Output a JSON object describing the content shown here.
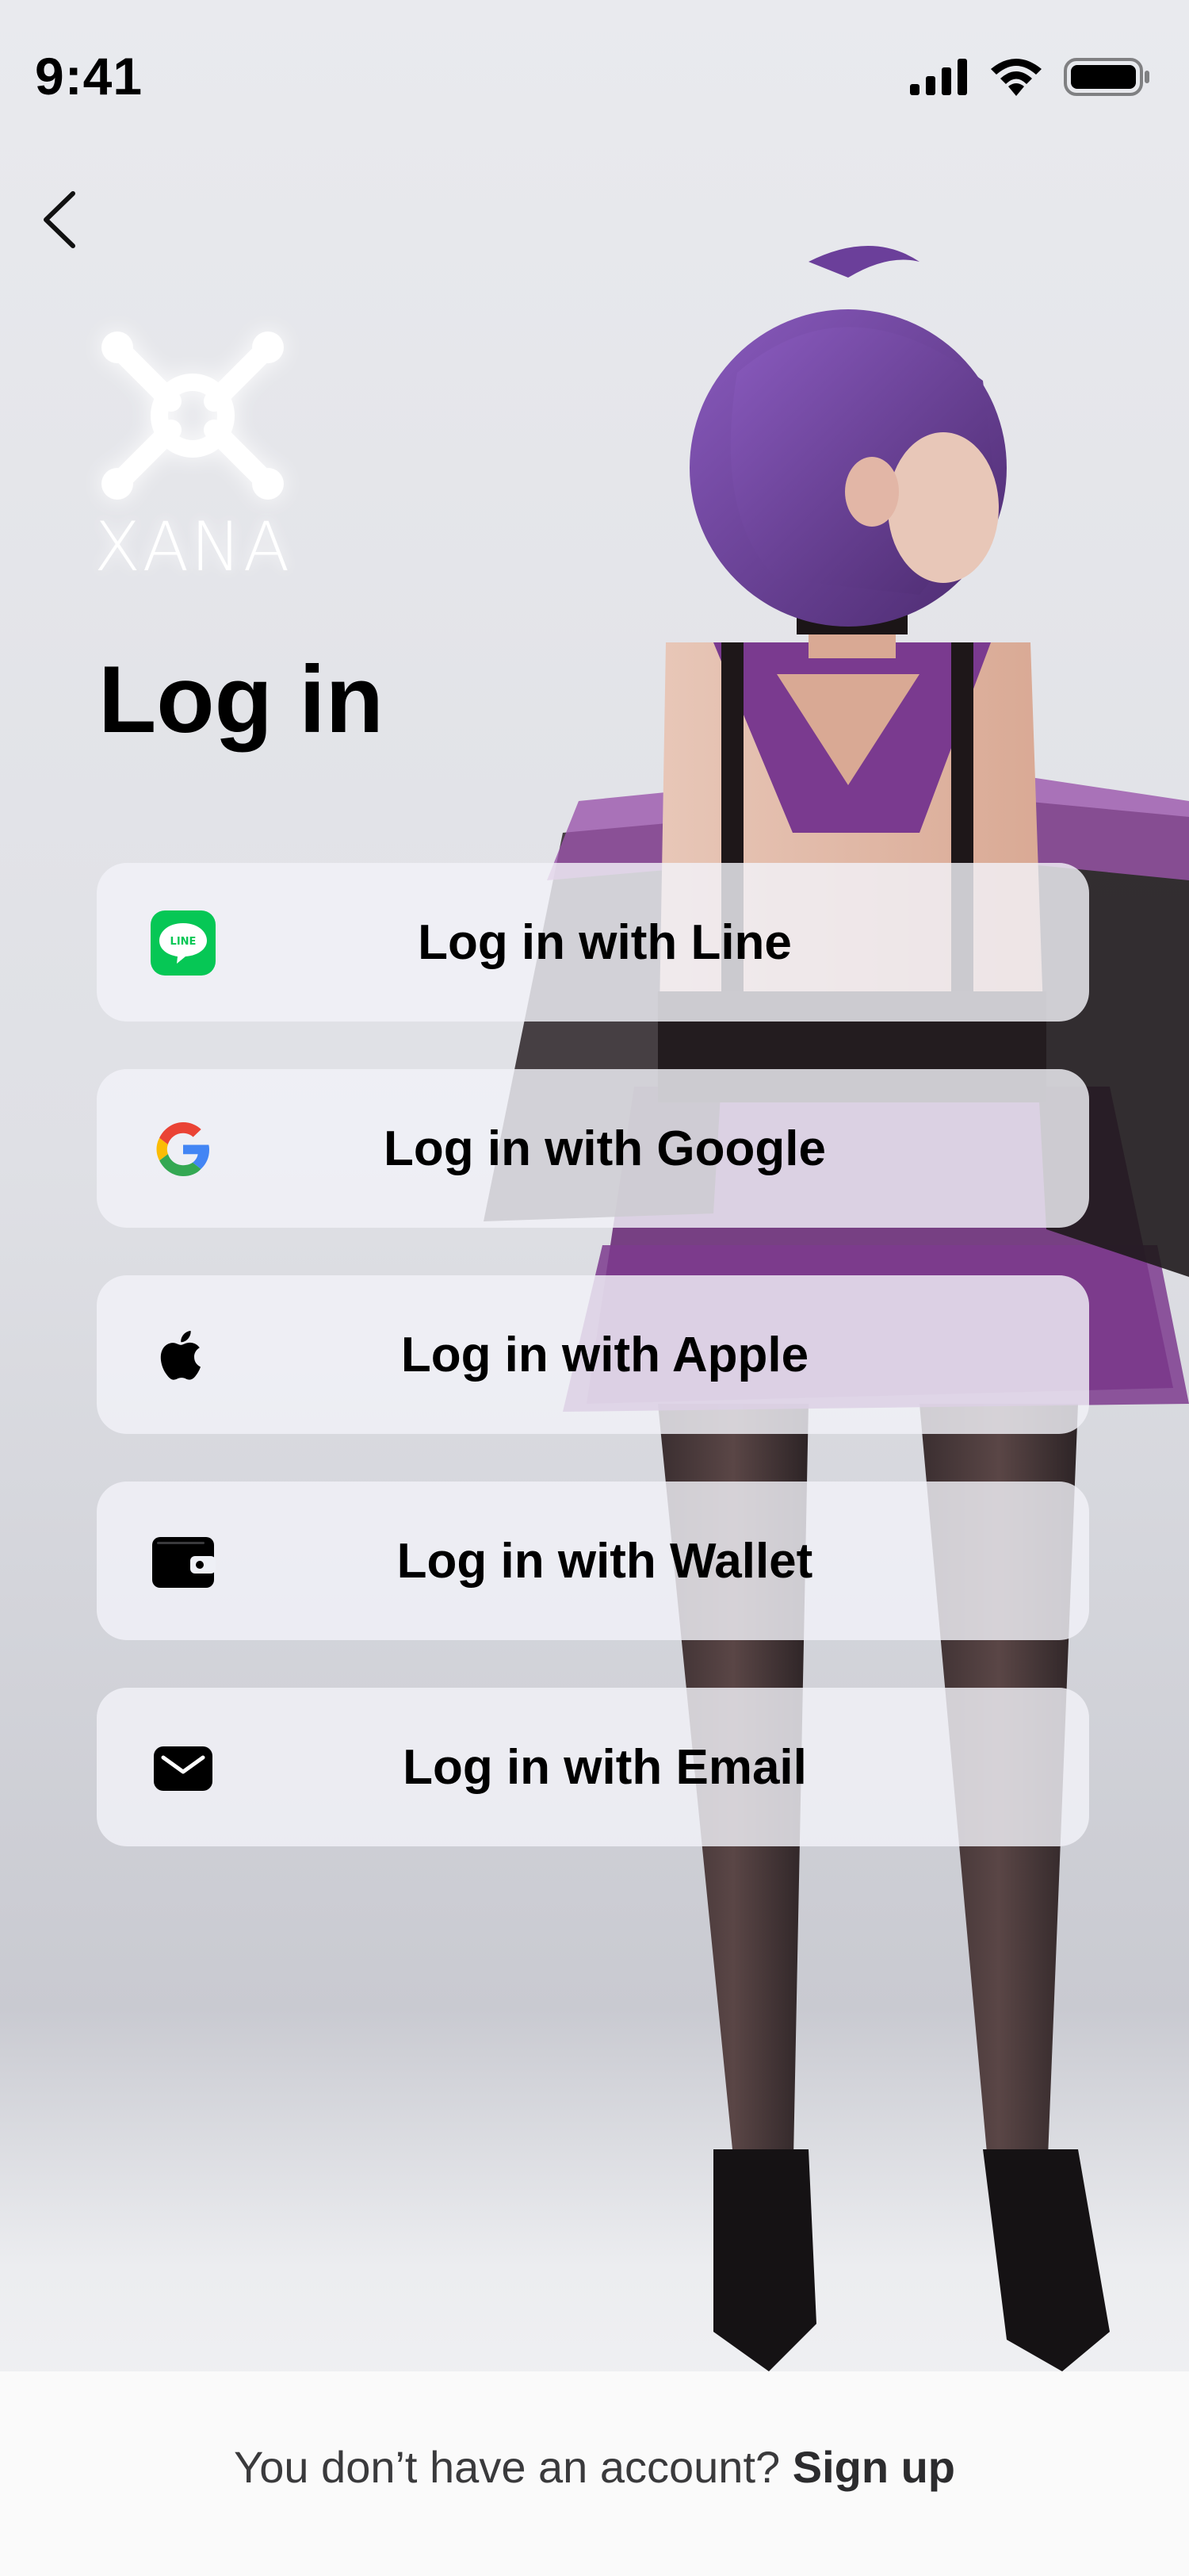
{
  "status_bar": {
    "time": "9:41",
    "icons": [
      "signal-icon",
      "wifi-icon",
      "battery-icon"
    ]
  },
  "header": {
    "back_icon": "chevron-left-icon"
  },
  "brand": {
    "logo_text": "XANA",
    "logo_color": "#ffffff"
  },
  "page": {
    "title": "Log in"
  },
  "login_options": [
    {
      "label": "Log in with Line",
      "icon": "line-icon"
    },
    {
      "label": "Log in with Google",
      "icon": "google-icon"
    },
    {
      "label": "Log in with Apple",
      "icon": "apple-icon"
    },
    {
      "label": "Log in with Wallet",
      "icon": "wallet-icon"
    },
    {
      "label": "Log in with Email",
      "icon": "email-icon"
    }
  ],
  "footer": {
    "prompt": "You don’t have an account? ",
    "signup_label": "Sign up"
  },
  "colors": {
    "line_green": "#06c755",
    "button_bg": "#f1f2f8",
    "text": "#000000",
    "accent_purple": "#7b3f9c"
  }
}
